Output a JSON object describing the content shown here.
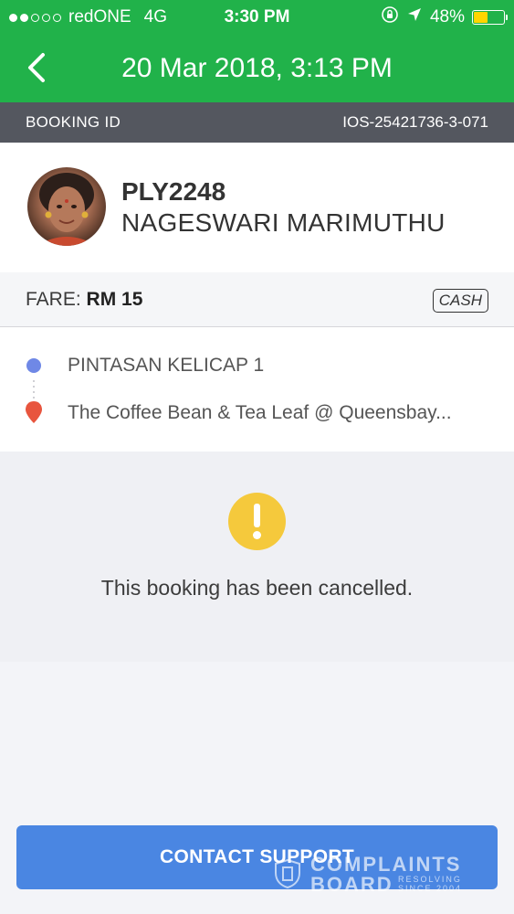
{
  "status_bar": {
    "carrier": "redONE",
    "network": "4G",
    "time": "3:30 PM",
    "battery_percent": "48%",
    "battery_level": 0.48,
    "signal_bars_filled": 2,
    "signal_bars_total": 5
  },
  "nav": {
    "title": "20 Mar 2018, 3:13 PM",
    "back_icon": "chevron-left-icon"
  },
  "booking": {
    "id_label": "BOOKING ID",
    "id_value": "IOS-25421736-3-071"
  },
  "driver": {
    "plate": "PLY2248",
    "name": "NAGESWARI MARIMUTHU"
  },
  "fare": {
    "label": "FARE:",
    "amount": "RM 15",
    "payment_method": "CASH"
  },
  "route": {
    "pickup": "PINTASAN KELICAP 1",
    "dropoff": "The Coffee Bean & Tea Leaf @ Queensbay..."
  },
  "status": {
    "message": "This booking has been cancelled.",
    "icon": "warning-icon"
  },
  "actions": {
    "contact_support": "CONTACT SUPPORT"
  },
  "watermark": {
    "line1": "COMPLAINTS",
    "line2": "BOARD",
    "tag1": "RESOLVING",
    "tag2": "SINCE 2004"
  },
  "colors": {
    "brand_green": "#21b24a",
    "strip_gray": "#54575f",
    "pickup_blue": "#6f88e6",
    "dropoff_red": "#e8553e",
    "warning_yellow": "#f5c93c",
    "button_blue": "#4a86e2",
    "battery_yellow": "#ffd500"
  }
}
